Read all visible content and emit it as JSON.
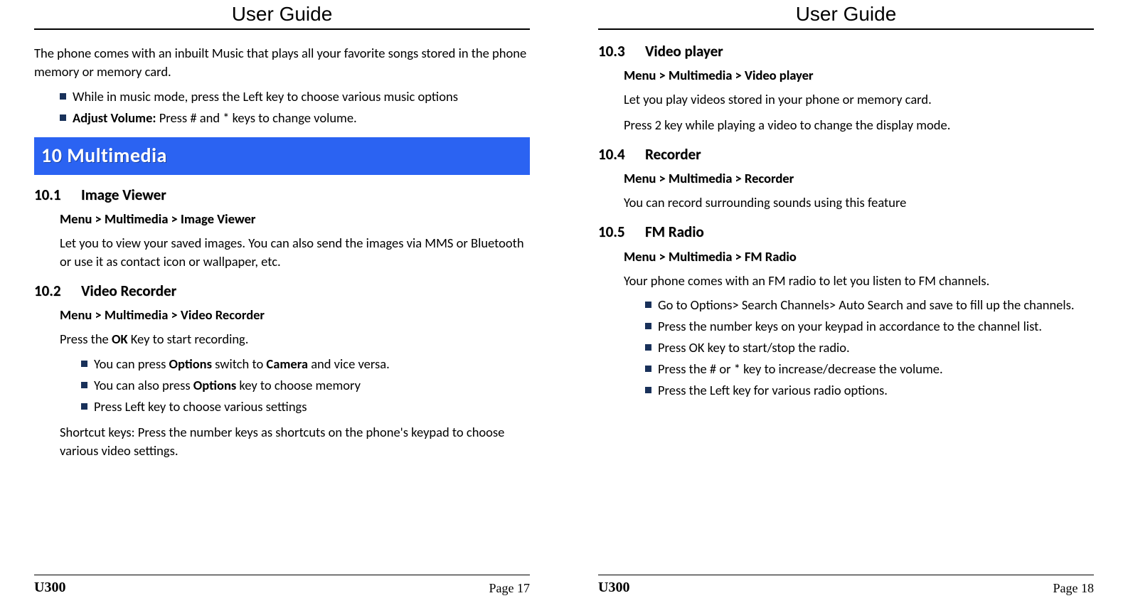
{
  "header": {
    "title": "User Guide"
  },
  "footer": {
    "model": "U300",
    "page_label_left": "Page 17",
    "page_label_right": "Page 18"
  },
  "left": {
    "intro": "The phone comes with an inbuilt Music that plays all your favorite songs stored in the phone memory or memory card.",
    "intro_bullets": {
      "b1": "While in music mode, press the Left key to choose various music options",
      "b2_bold": "Adjust Volume:",
      "b2_rest": " Press # and * keys to change volume."
    },
    "chapter": "10 Multimedia",
    "s101": {
      "num": "10.1",
      "title": "Image Viewer",
      "path": "Menu > Multimedia > Image Viewer",
      "p1": "Let you to view your saved images. You can also send the images via MMS or Bluetooth or use it as contact icon or wallpaper, etc."
    },
    "s102": {
      "num": "10.2",
      "title": "Video Recorder",
      "path": "Menu > Multimedia > Video Recorder",
      "p1_a": "Press the ",
      "p1_b": "OK",
      "p1_c": " Key to start recording.",
      "bul": {
        "b1_a": "You can press ",
        "b1_b": "Options",
        "b1_c": " switch to ",
        "b1_d": "Camera",
        "b1_e": " and vice versa.",
        "b2_a": "You can also press ",
        "b2_b": "Options",
        "b2_c": "  key to choose memory",
        "b3": "Press Left key to choose various settings"
      },
      "p2": "Shortcut keys: Press the number keys as shortcuts on the phone's keypad to choose various video settings."
    }
  },
  "right": {
    "s103": {
      "num": "10.3",
      "title": "Video player",
      "path": "Menu > Multimedia > Video player",
      "p1": "Let you play videos stored in your phone or memory card.",
      "p2": "Press 2 key while playing a video to change the display mode."
    },
    "s104": {
      "num": "10.4",
      "title": "Recorder",
      "path": "Menu > Multimedia > Recorder",
      "p1": "You can record surrounding sounds using this feature"
    },
    "s105": {
      "num": "10.5",
      "title": "FM Radio",
      "path": "Menu > Multimedia > FM Radio",
      "p1": "Your phone comes with an FM radio to let you listen to FM channels.",
      "bul": {
        "b1": "Go to Options> Search Channels> Auto Search and save to fill up the channels.",
        "b2": "Press the number keys on your keypad in accordance to the channel list.",
        "b3": "Press OK key to start/stop the radio.",
        "b4": "Press the # or * key to increase/decrease the volume.",
        "b5": "Press the Left key for various radio options."
      }
    }
  }
}
